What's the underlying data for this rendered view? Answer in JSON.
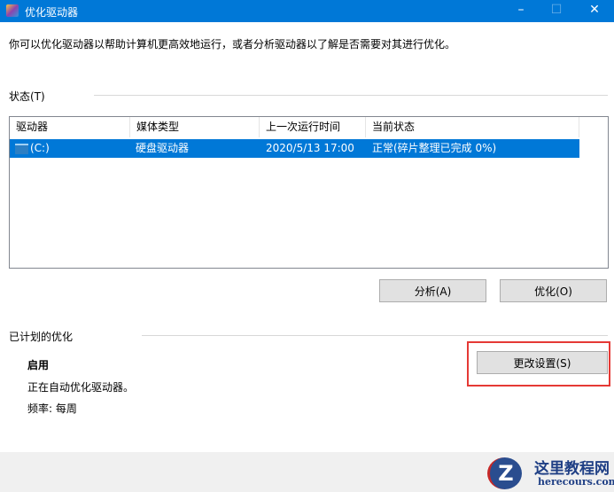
{
  "window": {
    "title": "优化驱动器",
    "minimize": "–",
    "maximize": "☐",
    "close": "✕"
  },
  "description": "你可以优化驱动器以帮助计算机更高效地运行，或者分析驱动器以了解是否需要对其进行优化。",
  "status": {
    "label": "状态(T)",
    "columns": [
      "驱动器",
      "媒体类型",
      "上一次运行时间",
      "当前状态"
    ],
    "rows": [
      {
        "drive": "(C:)",
        "media": "硬盘驱动器",
        "last_run": "2020/5/13 17:00",
        "state": "正常(碎片整理已完成 0%)"
      }
    ]
  },
  "buttons": {
    "analyze": "分析(A)",
    "optimize": "优化(O)",
    "change_settings": "更改设置(S)"
  },
  "scheduled": {
    "label": "已计划的优化",
    "state": "启用",
    "desc": "正在自动优化驱动器。",
    "frequency": "频率: 每周"
  },
  "watermark": {
    "title": "这里教程网",
    "url": "herecours.com"
  }
}
